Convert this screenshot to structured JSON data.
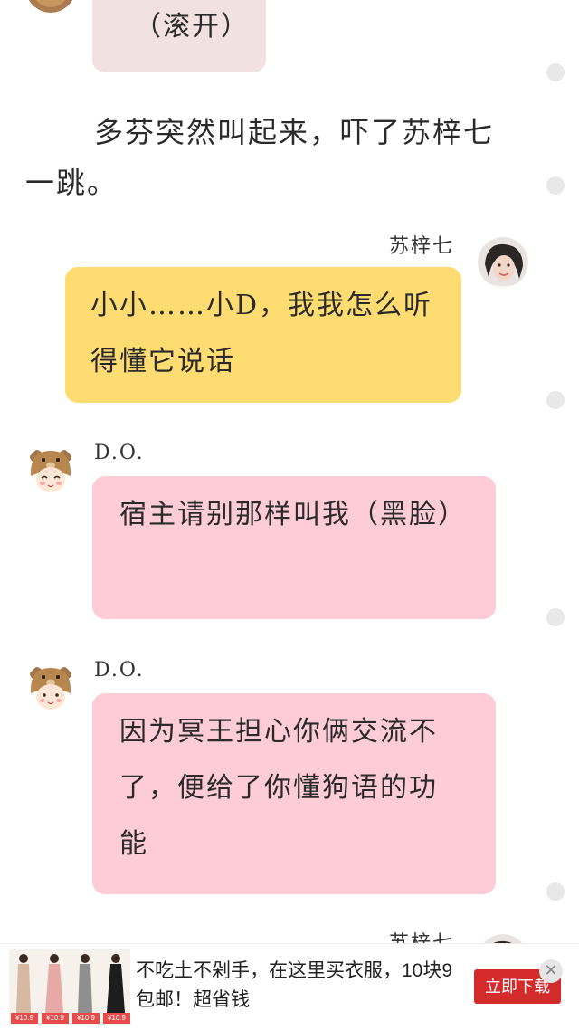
{
  "messages": {
    "top_bubble": "（滚开）",
    "narration": "多芬突然叫起来，吓了苏梓七一跳。",
    "msg1": {
      "sender": "苏梓七",
      "text": "小小……小D，我我怎么听得懂它说话"
    },
    "msg2": {
      "sender": "D.O.",
      "text": "宿主请别那样叫我（黑脸）"
    },
    "msg3": {
      "sender": "D.O.",
      "text": "因为冥王担心你俩交流不了，便给了你懂狗语的功能"
    },
    "partial_sender": "苏梓七"
  },
  "ad": {
    "text": "不吃土不剁手，在这里买衣服，10块9包邮！超省钱",
    "button": "立即下载",
    "price_tags": [
      "¥10.9",
      "¥10.9",
      "¥10.9",
      "¥10.9"
    ],
    "close": "✕"
  },
  "colors": {
    "gray_bubble": "#f2e1e1",
    "yellow_bubble": "#fedc72",
    "pink_bubble": "#fdccd6",
    "ad_button": "#d32b2b"
  },
  "icons": {
    "avatar_user": "girl-photo-avatar",
    "avatar_bot": "bear-hat-cartoon-avatar",
    "side_dot": "gray-dot"
  }
}
